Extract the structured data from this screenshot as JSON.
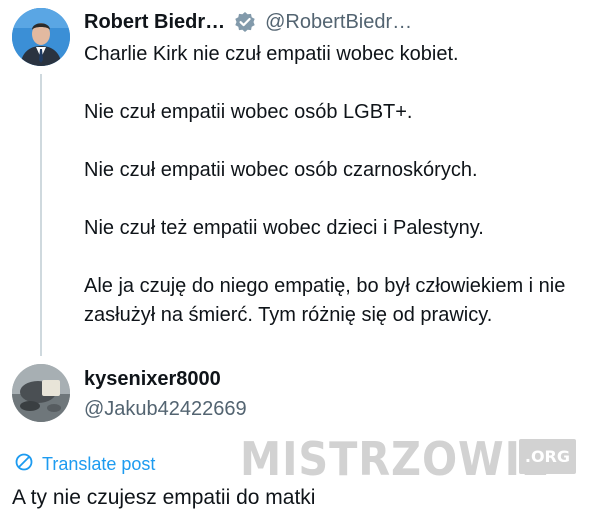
{
  "tweet": {
    "display_name": "Robert Biedr…",
    "handle": "@RobertBiedr…",
    "verified_color": "#829aab",
    "paragraphs": [
      "Charlie Kirk nie czuł empatii wobec kobiet.",
      "Nie czuł empatii wobec osób LGBT+.",
      "Nie czuł empatii wobec osób czarnoskórych.",
      "Nie czuł też empatii wobec dzieci i Palestyny.",
      "Ale ja czuję do niego empatię, bo był człowiekiem i nie zasłużył na śmierć. Tym różnię się od prawicy."
    ]
  },
  "reply": {
    "display_name": "kysenixer8000",
    "handle": "@Jakub42422669",
    "translate_label": "Translate post",
    "text": "A ty nie czujesz empatii do matki"
  },
  "watermark": {
    "text": "MISTRZOWIE",
    "suffix": ".ORG"
  },
  "colors": {
    "link": "#1d9bf0",
    "secondary_text": "#536471",
    "thread_line": "#cfd9de"
  },
  "icons": {
    "verified": "verified-badge-icon",
    "translate": "globe-icon"
  }
}
